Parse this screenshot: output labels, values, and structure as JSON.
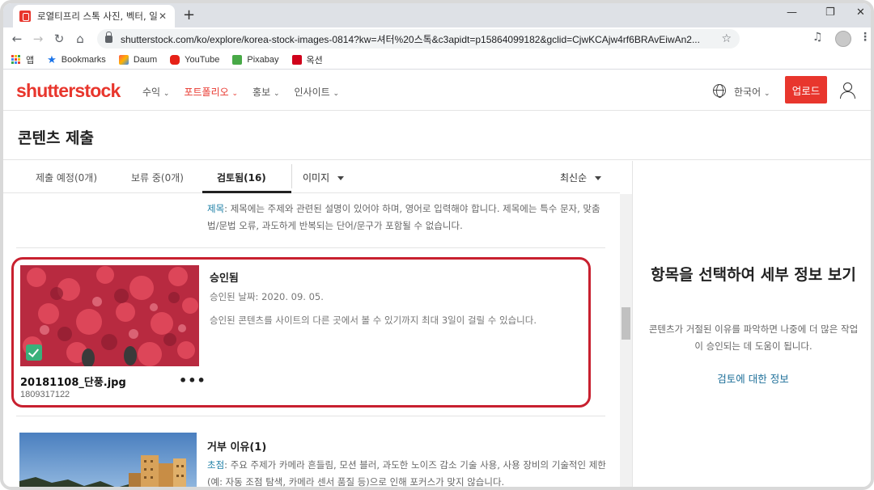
{
  "browser": {
    "tab_title": "로열티프리 스톡 사진, 벡터, 일러",
    "new_tab": "+",
    "close_tab": "✕",
    "url": "shutterstock.com/ko/explore/korea-stock-images-0814?kw=셔터%20스톡&c3apidt=p15864099182&gclid=CjwKCAjw4rf6BRAvEiwAn2...",
    "window_controls": [
      "—",
      "❐",
      "✕"
    ]
  },
  "bookmarks": [
    {
      "label": "앱",
      "icon": "apps-icon"
    },
    {
      "label": "Bookmarks",
      "icon": "star-icon"
    },
    {
      "label": "Daum",
      "icon": "daum-icon"
    },
    {
      "label": "YouTube",
      "icon": "youtube-icon"
    },
    {
      "label": "Pixabay",
      "icon": "pixabay-icon"
    },
    {
      "label": "옥션",
      "icon": "auction-icon"
    }
  ],
  "header": {
    "logo": "shutterstock",
    "nav": [
      {
        "label": "수익"
      },
      {
        "label": "포트폴리오"
      },
      {
        "label": "홍보"
      },
      {
        "label": "인사이트"
      }
    ],
    "language": "한국어",
    "upload_label": "업로드"
  },
  "page": {
    "title": "콘텐츠 제출"
  },
  "tabs": {
    "pending_submit": "제출 예정(0개)",
    "on_hold": "보류 중(0개)",
    "reviewed": "검토됨(16)",
    "type_filter": "이미지",
    "sort": "최신순"
  },
  "previous_note": {
    "keyword": "제목",
    "text": ": 제목에는 주제와 관련된 설명이 있어야 하며, 영어로 입력해야 합니다. 제목에는 특수 문자, 맞춤법/문법 오류, 과도하게 반복되는 단어/문구가 포함될 수 없습니다."
  },
  "approved_item": {
    "status": "승인됨",
    "date": "승인된 날짜: 2020. 09. 05.",
    "message": "승인된 콘텐츠를 사이트의 다른 곳에서 볼 수 있기까지 최대 3일이 걸릴 수 있습니다.",
    "file_name": "20181108_단풍.jpg",
    "file_id": "1809317122",
    "more": "•••"
  },
  "rejected_item": {
    "title": "거부 이유(1)",
    "keyword": "초점",
    "text": ": 주요 주제가 카메라 흔들림, 모션 블러, 과도한 노이즈 감소 기술 사용, 사용 장비의 기술적인 제한(예: 자동 조점 탐색, 카메라 센서 품질 등)으로 인해 포커스가 맞지 않습니다."
  },
  "detail_panel": {
    "title": "항목을 선택하여 세부 정보 보기",
    "description": "콘텐츠가 거절된 이유를 파악하면 나중에 더 많은 작업이 승인되는 데 도움이 됩니다.",
    "link": "검토에 대한 정보"
  },
  "colors": {
    "brand": "#e8362d",
    "highlight_border": "#c8202f",
    "link": "#1d6f99",
    "approved_check": "#3ab07b"
  }
}
